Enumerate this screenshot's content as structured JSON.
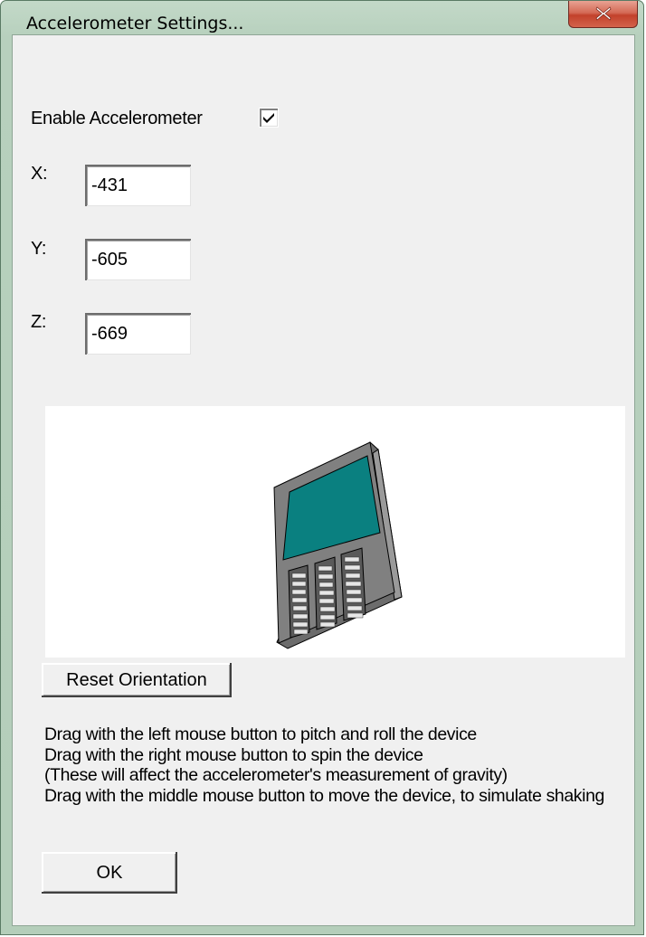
{
  "window": {
    "title": "Accelerometer Settings...",
    "close_icon": "close-icon"
  },
  "enable": {
    "label": "Enable Accelerometer",
    "checked": true
  },
  "axes": [
    {
      "label": "X:",
      "value": "-431"
    },
    {
      "label": "Y:",
      "value": "-605"
    },
    {
      "label": "Z:",
      "value": "-669"
    }
  ],
  "preview": {
    "icon": "phone-icon",
    "screen_color": "#0a8080",
    "body_color": "#808080"
  },
  "reset_button": "Reset Orientation",
  "help_lines": [
    "Drag with the left mouse button to pitch and roll the device",
    "Drag with the right mouse button to spin the device",
    "(These will affect the accelerometer's measurement of gravity)",
    "Drag with the middle mouse button to move the device, to simulate shaking"
  ],
  "ok_button": "OK"
}
